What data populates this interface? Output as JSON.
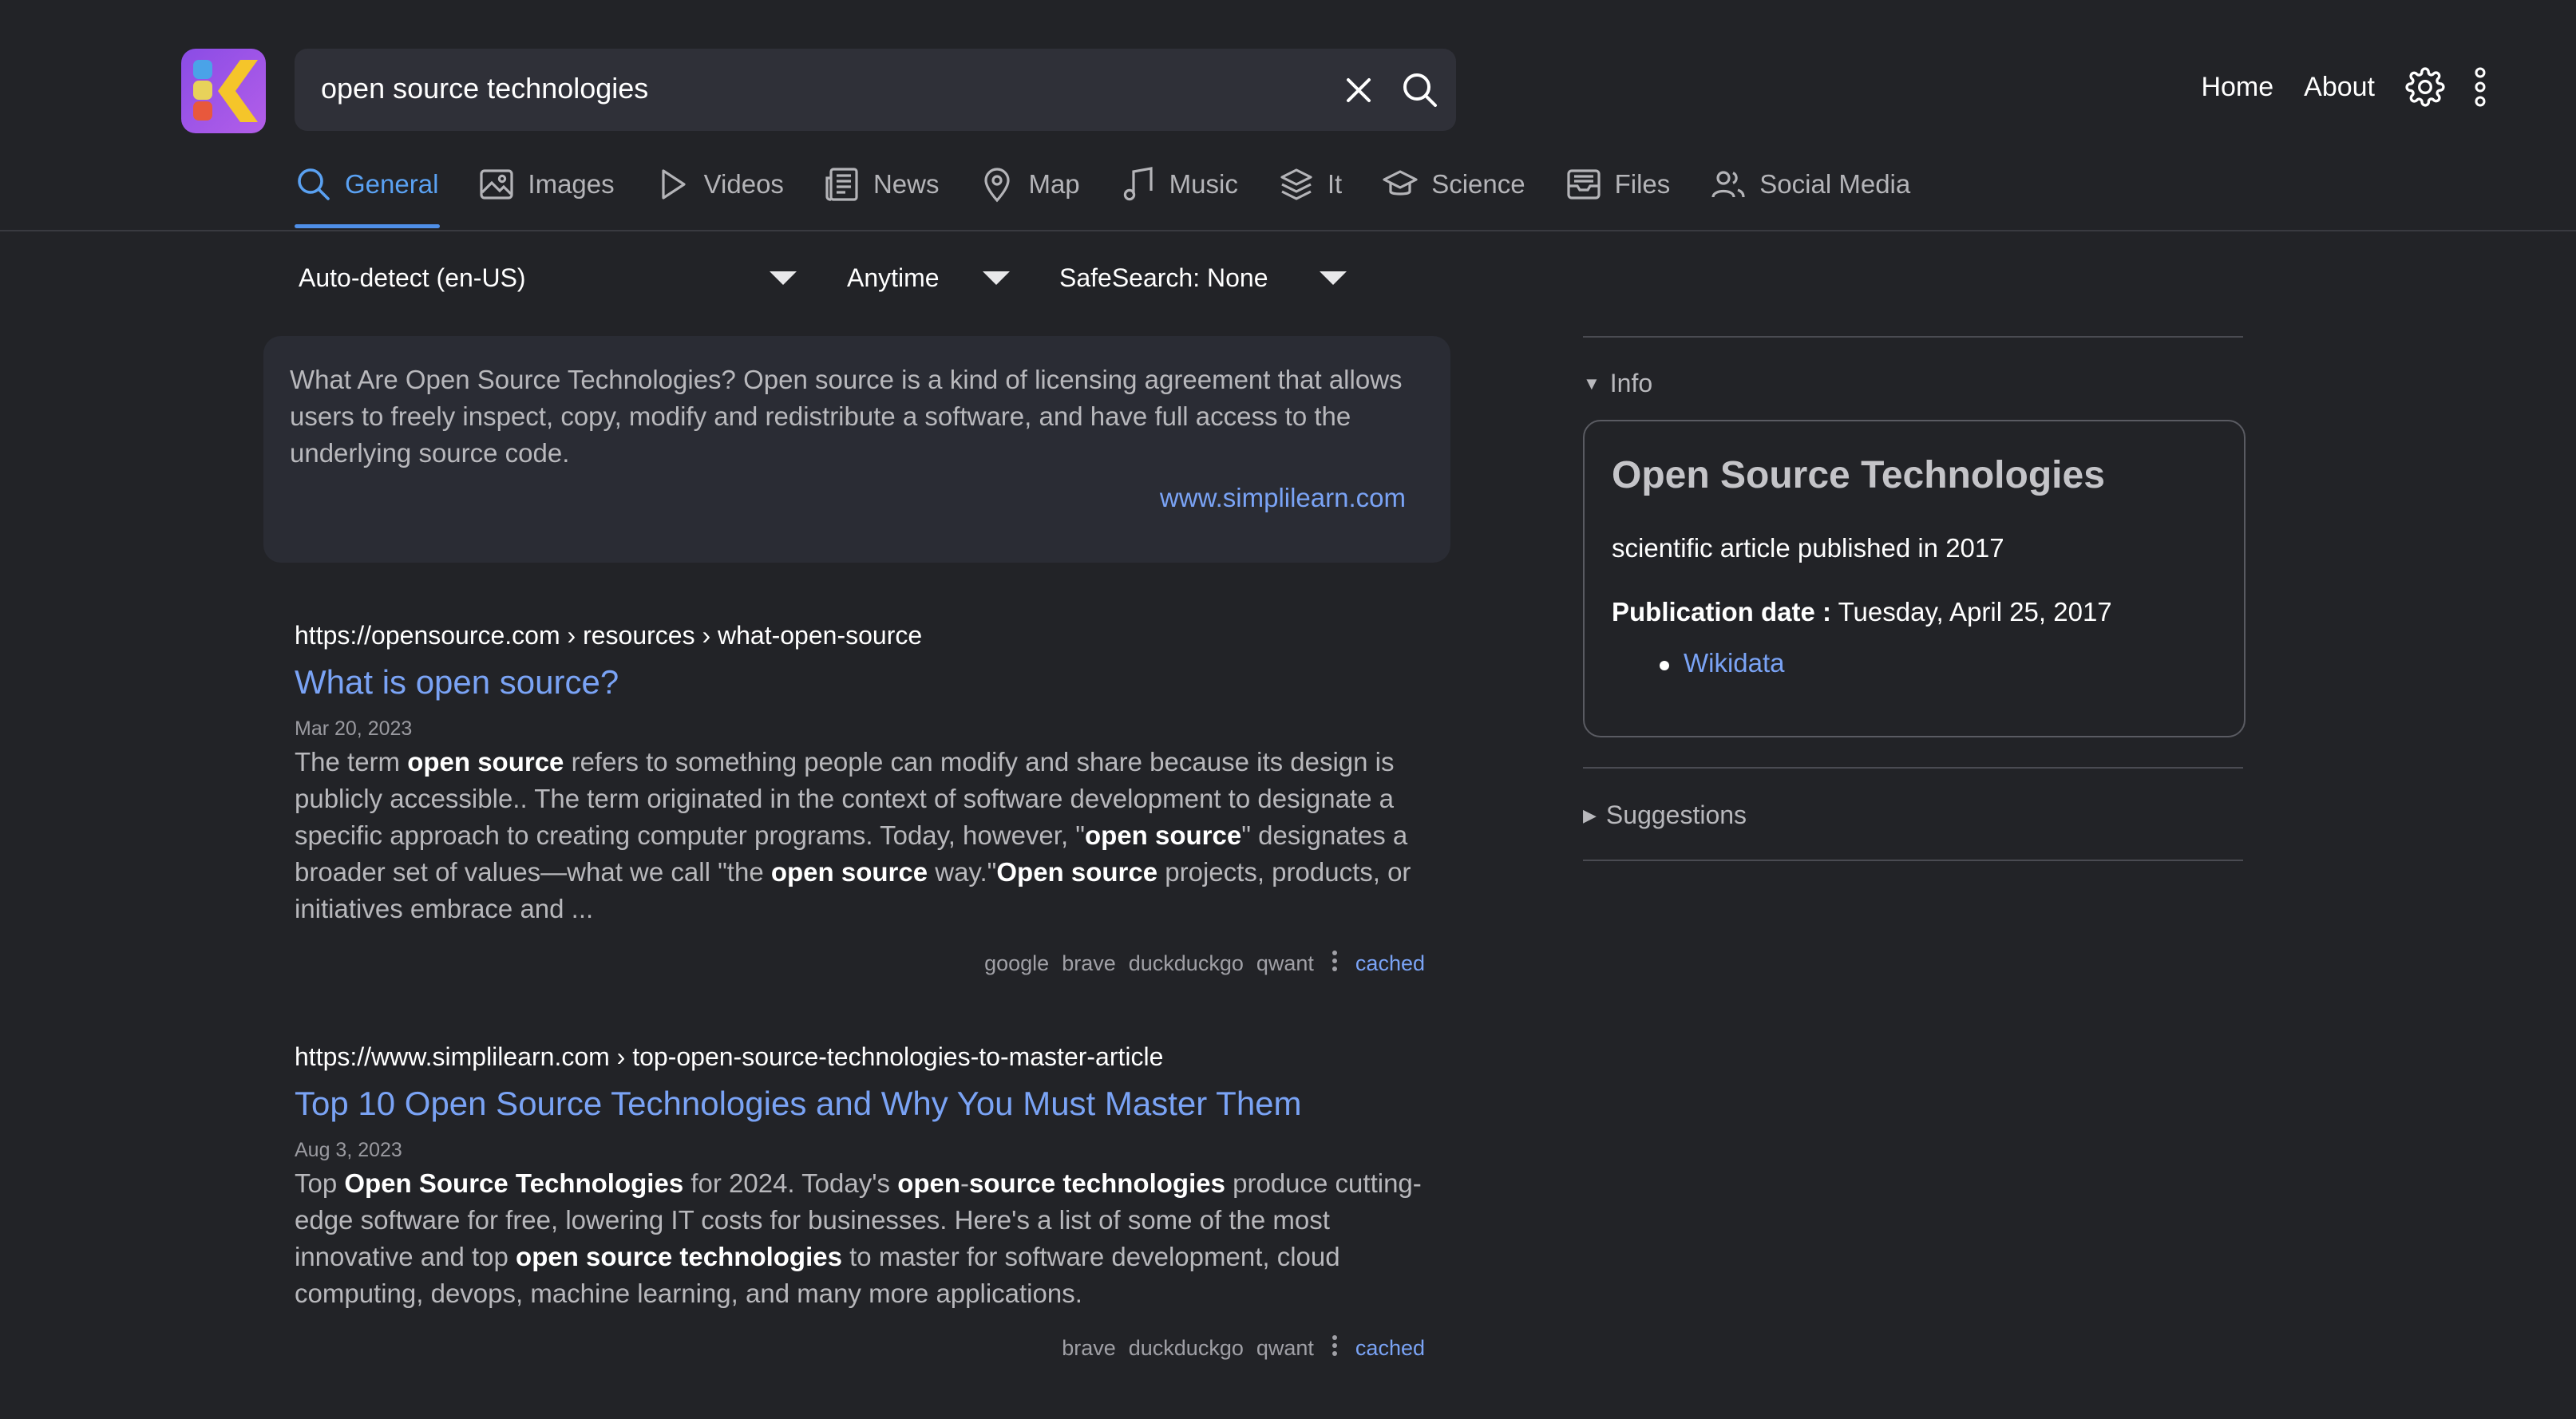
{
  "search": {
    "query": "open source technologies"
  },
  "header": {
    "home_label": "Home",
    "about_label": "About"
  },
  "tabs": [
    {
      "label": "General",
      "icon": "search-icon"
    },
    {
      "label": "Images",
      "icon": "image-icon"
    },
    {
      "label": "Videos",
      "icon": "play-icon"
    },
    {
      "label": "News",
      "icon": "newspaper-icon"
    },
    {
      "label": "Map",
      "icon": "map-pin-icon"
    },
    {
      "label": "Music",
      "icon": "music-icon"
    },
    {
      "label": "It",
      "icon": "layers-icon"
    },
    {
      "label": "Science",
      "icon": "graduation-cap-icon"
    },
    {
      "label": "Files",
      "icon": "inbox-icon"
    },
    {
      "label": "Social Media",
      "icon": "users-icon"
    }
  ],
  "filters": {
    "language": "Auto-detect (en-US)",
    "time": "Anytime",
    "safesearch": "SafeSearch: None"
  },
  "answer": {
    "text": "What Are Open Source Technologies? Open source is a kind of licensing agreement that allows users to freely inspect, copy, modify and redistribute a software, and have full access to the underlying source code.",
    "link": "www.simplilearn.com"
  },
  "results": [
    {
      "url": "https://opensource.com",
      "path": " › resources › what-open-source",
      "title": "What is open source?",
      "date": "Mar 20, 2023",
      "snippet_parts": [
        [
          "The term ",
          false
        ],
        [
          "open source",
          true
        ],
        [
          " refers to something people can modify and share because its design is publicly accessible.. The term originated in the context of software development to designate a specific approach to creating computer programs. Today, however, \"",
          false
        ],
        [
          "open source",
          true
        ],
        [
          "\" designates a broader set of values—what we call \"the ",
          false
        ],
        [
          "open source",
          true
        ],
        [
          " way.\"",
          false
        ],
        [
          "Open source",
          true
        ],
        [
          " projects, products, or initiatives embrace and ...",
          false
        ]
      ],
      "engines": [
        "google",
        "brave",
        "duckduckgo",
        "qwant"
      ],
      "cached_label": "cached"
    },
    {
      "url": "https://www.simplilearn.com",
      "path": " › top-open-source-technologies-to-master-article",
      "title": "Top 10 Open Source Technologies and Why You Must Master Them",
      "date": "Aug 3, 2023",
      "snippet_parts": [
        [
          "Top ",
          false
        ],
        [
          "Open Source Technologies",
          true
        ],
        [
          " for 2024. Today's ",
          false
        ],
        [
          "open",
          true
        ],
        [
          "-",
          false
        ],
        [
          "source technologies",
          true
        ],
        [
          " produce cutting-edge software for free, lowering IT costs for businesses. Here's a list of some of the most innovative and top ",
          false
        ],
        [
          "open source technologies",
          true
        ],
        [
          " to master for software development, cloud computing, devops, machine learning, and many more applications.",
          false
        ]
      ],
      "engines": [
        "brave",
        "duckduckgo",
        "qwant"
      ],
      "cached_label": "cached"
    }
  ],
  "sidebar": {
    "info_label": "Info",
    "info_title": "Open Source Technologies",
    "info_desc": "scientific article published in 2017",
    "pub_label": "Publication date :",
    "pub_value": " Tuesday, April 25, 2017",
    "wikidata_label": "Wikidata",
    "suggestions_label": "Suggestions"
  },
  "colors": {
    "accent": "#7aa3f5",
    "active_tab": "#5aa1f2",
    "background": "#222327"
  }
}
